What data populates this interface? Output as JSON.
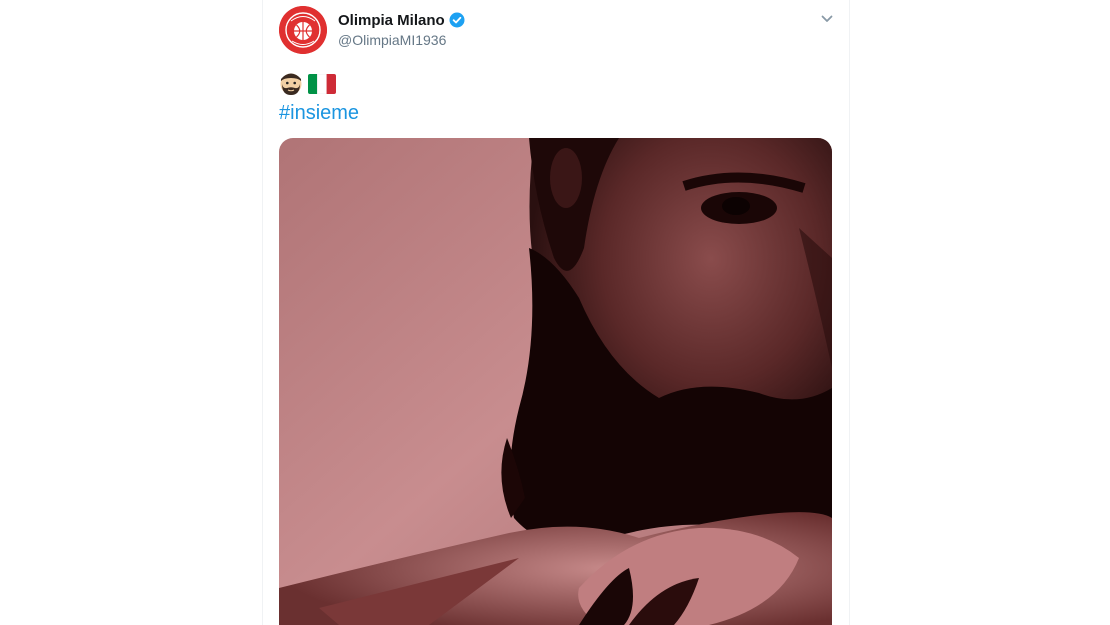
{
  "tweet": {
    "display_name": "Olimpia Milano",
    "handle": "@OlimpiaMI1936",
    "verified": true,
    "emojis": [
      "bearded-man-emoji",
      "italy-flag-emoji"
    ],
    "hashtag": "#insieme",
    "media_alt_icon": "photo-bearded-man",
    "avatar_icon": "olimpia-milano-logo",
    "menu_icon": "chevron-down-icon"
  },
  "colors": {
    "brand_red": "#e03030",
    "hashtag_blue": "#1b95e0",
    "verified_blue": "#1da1f2",
    "name_text": "#14171a",
    "handle_text": "#657786",
    "photo_tint": "#b8787a"
  }
}
